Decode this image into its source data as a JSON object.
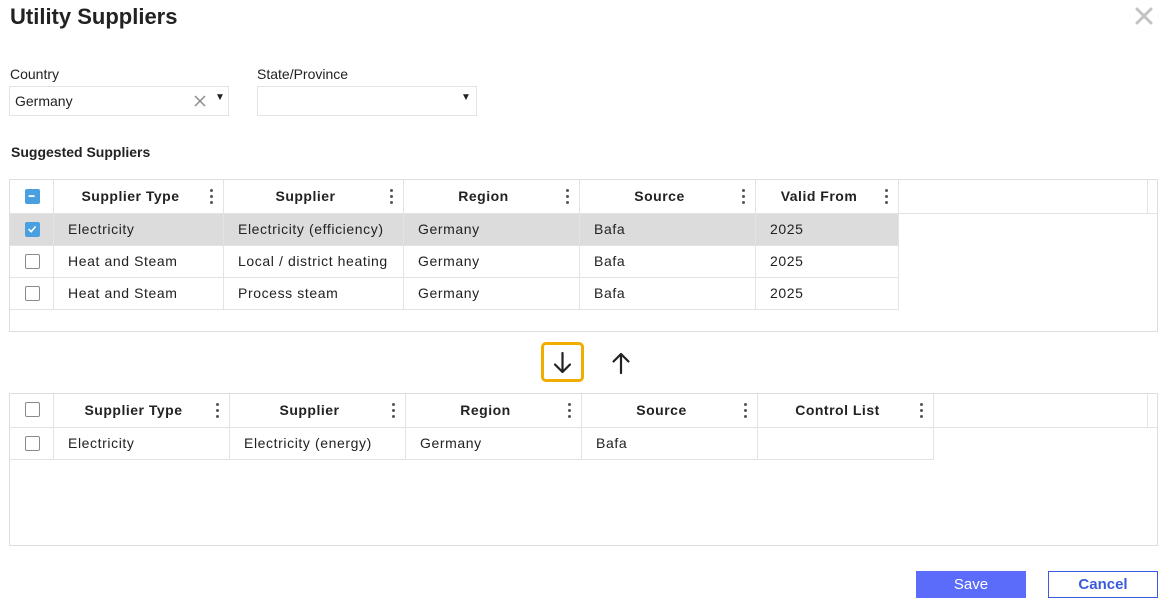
{
  "dialog": {
    "title": "Utility Suppliers"
  },
  "filters": {
    "country": {
      "label": "Country",
      "value": "Germany"
    },
    "state": {
      "label": "State/Province",
      "value": ""
    }
  },
  "suggested": {
    "title": "Suggested Suppliers",
    "columns": [
      "Supplier Type",
      "Supplier",
      "Region",
      "Source",
      "Valid From"
    ],
    "header_checkbox": "partial",
    "rows": [
      {
        "checked": true,
        "cells": [
          "Electricity",
          "Electricity (efficiency)",
          "Germany",
          "Bafa",
          "2025"
        ]
      },
      {
        "checked": false,
        "cells": [
          "Heat and Steam",
          "Local / district heating",
          "Germany",
          "Bafa",
          "2025"
        ]
      },
      {
        "checked": false,
        "cells": [
          "Heat and Steam",
          "Process steam",
          "Germany",
          "Bafa",
          "2025"
        ]
      }
    ]
  },
  "selected": {
    "columns": [
      "Supplier Type",
      "Supplier",
      "Region",
      "Source",
      "Control List"
    ],
    "header_checkbox": "unchecked",
    "rows": [
      {
        "checked": false,
        "cells": [
          "Electricity",
          "Electricity (energy)",
          "Germany",
          "Bafa",
          ""
        ]
      }
    ]
  },
  "actions": {
    "move_down_icon": "arrow-down-icon",
    "move_up_icon": "arrow-up-icon",
    "save": "Save",
    "cancel": "Cancel"
  },
  "colors": {
    "accent": "#5b6cfb",
    "focus": "#f0ad00",
    "checkbox": "#4a9fe0",
    "row_selected": "#dcdcdc"
  }
}
